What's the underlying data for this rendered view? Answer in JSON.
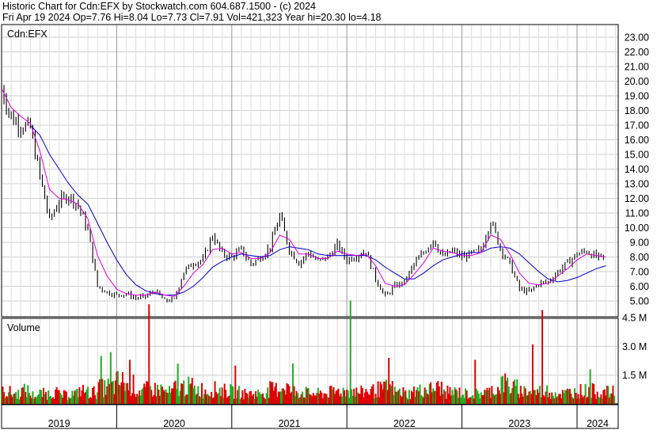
{
  "header": {
    "line1": "Historic Chart for Cdn:EFX by Stockwatch.com 604.687.1500 - (c) 2024",
    "line2": "Fri Apr 19 2024   Op=7.76  Hi=8.04  Lo=7.73  Cl=7.91  Vol=421,323  Year hi=20.30  lo=4.18"
  },
  "chart_data": [
    {
      "type": "line",
      "panel": "price",
      "label": "Cdn:EFX",
      "ylim": [
        4.0,
        23.5
      ],
      "y_ticks": [
        "5.00",
        "6.00",
        "7.00",
        "8.00",
        "9.00",
        "10.00",
        "11.00",
        "12.00",
        "13.00",
        "14.00",
        "15.00",
        "16.00",
        "17.00",
        "18.00",
        "19.00",
        "20.00",
        "21.00",
        "22.00",
        "23.00"
      ],
      "x_ticks": [
        "2019",
        "2020",
        "2021",
        "2022",
        "2023",
        "2024"
      ],
      "grid": true,
      "colors": {
        "price": "#000000",
        "ma_short": "#dd00dd",
        "ma_long": "#0000cc"
      },
      "series": [
        {
          "key": "close",
          "x": [
            "2019-01",
            "2019-02",
            "2019-03",
            "2019-04",
            "2019-05",
            "2019-06",
            "2019-07",
            "2019-08",
            "2019-09",
            "2019-10",
            "2019-11",
            "2019-12",
            "2020-01",
            "2020-02",
            "2020-03",
            "2020-04",
            "2020-05",
            "2020-06",
            "2020-07",
            "2020-08",
            "2020-09",
            "2020-10",
            "2020-11",
            "2020-12",
            "2021-01",
            "2021-02",
            "2021-03",
            "2021-04",
            "2021-05",
            "2021-06",
            "2021-07",
            "2021-08",
            "2021-09",
            "2021-10",
            "2021-11",
            "2021-12",
            "2022-01",
            "2022-02",
            "2022-03",
            "2022-04",
            "2022-05",
            "2022-06",
            "2022-07",
            "2022-08",
            "2022-09",
            "2022-10",
            "2022-11",
            "2022-12",
            "2023-01",
            "2023-02",
            "2023-03",
            "2023-04",
            "2023-05",
            "2023-06",
            "2023-07",
            "2023-08",
            "2023-09",
            "2023-10",
            "2023-11",
            "2023-12",
            "2024-01",
            "2024-02",
            "2024-03",
            "2024-04"
          ],
          "values": [
            19.5,
            17.5,
            17.0,
            16.8,
            13.5,
            10.5,
            11.8,
            12.2,
            11.5,
            9.8,
            6.0,
            5.6,
            5.4,
            5.5,
            5.2,
            5.3,
            5.7,
            5.0,
            5.1,
            7.0,
            7.6,
            7.8,
            9.5,
            8.2,
            8.0,
            8.5,
            7.5,
            8.0,
            8.7,
            10.8,
            8.5,
            7.6,
            8.3,
            7.7,
            8.0,
            8.8,
            7.8,
            8.1,
            8.4,
            6.5,
            5.3,
            6.0,
            6.3,
            7.5,
            8.3,
            9.2,
            8.0,
            8.4,
            8.0,
            8.2,
            8.5,
            10.5,
            8.6,
            7.5,
            5.8,
            5.6,
            6.2,
            6.3,
            7.0,
            7.6,
            8.2,
            8.4,
            8.0,
            7.9
          ]
        },
        {
          "key": "ma_short",
          "values": [
            19.5,
            18.2,
            17.6,
            17.1,
            15.2,
            12.6,
            12.0,
            11.9,
            11.6,
            10.6,
            8.1,
            6.7,
            5.8,
            5.5,
            5.4,
            5.4,
            5.6,
            5.4,
            5.3,
            6.0,
            6.9,
            7.5,
            8.5,
            8.6,
            8.2,
            8.3,
            7.9,
            7.9,
            8.3,
            9.5,
            9.2,
            8.2,
            8.2,
            7.9,
            7.9,
            8.4,
            8.2,
            8.1,
            8.2,
            7.4,
            6.2,
            6.0,
            6.1,
            6.8,
            7.6,
            8.6,
            8.4,
            8.3,
            8.1,
            8.1,
            8.3,
            9.5,
            9.2,
            8.2,
            6.9,
            6.2,
            6.1,
            6.2,
            6.7,
            7.2,
            7.8,
            8.2,
            8.1,
            8.0
          ]
        },
        {
          "key": "ma_long",
          "values": [
            null,
            null,
            null,
            17.0,
            16.3,
            15.0,
            14.0,
            13.0,
            12.2,
            11.6,
            10.3,
            9.0,
            7.8,
            6.8,
            6.1,
            5.7,
            5.5,
            5.4,
            5.4,
            5.6,
            6.0,
            6.6,
            7.3,
            7.7,
            8.0,
            8.2,
            8.1,
            8.0,
            8.1,
            8.5,
            8.7,
            8.6,
            8.5,
            8.2,
            8.1,
            8.1,
            8.1,
            8.1,
            8.1,
            7.8,
            7.3,
            6.9,
            6.5,
            6.5,
            6.9,
            7.4,
            7.8,
            8.0,
            8.2,
            8.3,
            8.3,
            8.6,
            8.7,
            8.6,
            8.2,
            7.6,
            7.0,
            6.5,
            6.3,
            6.4,
            6.6,
            6.9,
            7.2,
            7.4
          ]
        }
      ]
    },
    {
      "type": "bar",
      "panel": "volume",
      "label": "Volume",
      "y_ticks": [
        "1.5 M",
        "3.0 M",
        "4.5 M"
      ],
      "ylim": [
        0,
        5.5
      ],
      "colors": {
        "up": "#22aa22",
        "down": "#dd0000"
      },
      "values_millions_by_month": [
        0.8,
        0.7,
        0.9,
        0.6,
        0.7,
        0.8,
        0.6,
        0.7,
        0.9,
        0.8,
        1.1,
        1.2,
        1.5,
        1.3,
        0.9,
        1.0,
        1.0,
        0.8,
        1.1,
        1.2,
        1.0,
        0.9,
        1.0,
        0.9,
        0.8,
        0.7,
        0.7,
        0.8,
        1.0,
        1.2,
        0.9,
        0.8,
        0.7,
        0.7,
        0.8,
        0.9,
        0.9,
        0.8,
        0.9,
        1.0,
        1.1,
        0.8,
        0.7,
        0.9,
        1.0,
        1.1,
        0.8,
        0.8,
        0.7,
        0.7,
        0.8,
        1.0,
        1.4,
        1.1,
        0.9,
        0.8,
        0.9,
        0.8,
        0.7,
        0.8,
        0.9,
        0.9,
        0.8,
        0.8
      ],
      "spikes_millions": [
        {
          "x": "2019-11",
          "value": 2.5
        },
        {
          "x": "2019-12",
          "value": 2.7
        },
        {
          "x": "2020-02",
          "value": 2.3
        },
        {
          "x": "2020-04",
          "value": 5.2
        },
        {
          "x": "2020-07",
          "value": 2.1
        },
        {
          "x": "2021-01",
          "value": 2.0
        },
        {
          "x": "2021-07",
          "value": 2.1
        },
        {
          "x": "2022-01",
          "value": 5.4
        },
        {
          "x": "2022-05",
          "value": 2.4
        },
        {
          "x": "2023-02",
          "value": 2.3
        },
        {
          "x": "2023-08",
          "value": 3.1
        },
        {
          "x": "2023-09",
          "value": 4.9
        },
        {
          "x": "2024-02",
          "value": 1.8
        }
      ]
    }
  ]
}
